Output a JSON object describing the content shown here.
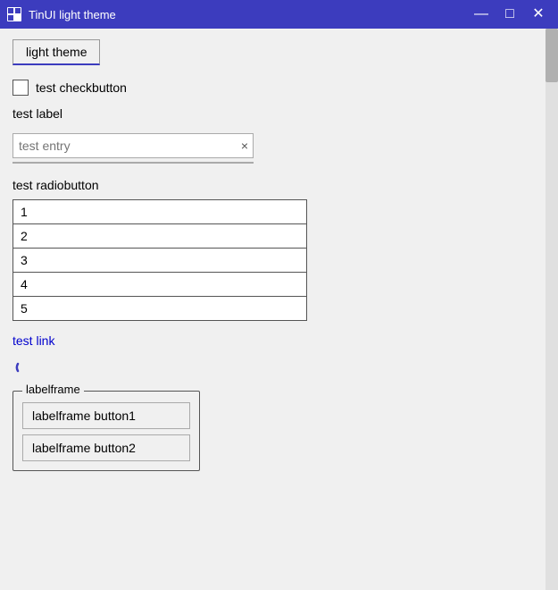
{
  "titlebar": {
    "title": "TinUI light theme",
    "minimize_label": "—",
    "maximize_label": "□",
    "close_label": "✕"
  },
  "tab": {
    "label": "light theme"
  },
  "checkbutton": {
    "label": "test checkbutton"
  },
  "label": {
    "text": "test label"
  },
  "entry": {
    "placeholder": "test entry",
    "clear_label": "×"
  },
  "radiobutton": {
    "label": "test radiobutton"
  },
  "listbox": {
    "items": [
      {
        "value": "1"
      },
      {
        "value": "2"
      },
      {
        "value": "3"
      },
      {
        "value": "4"
      },
      {
        "value": "5"
      }
    ]
  },
  "link": {
    "text": "test link"
  },
  "labelframe": {
    "legend": "labelframe",
    "button1_label": "labelframe button1",
    "button2_label": "labelframe button2"
  }
}
